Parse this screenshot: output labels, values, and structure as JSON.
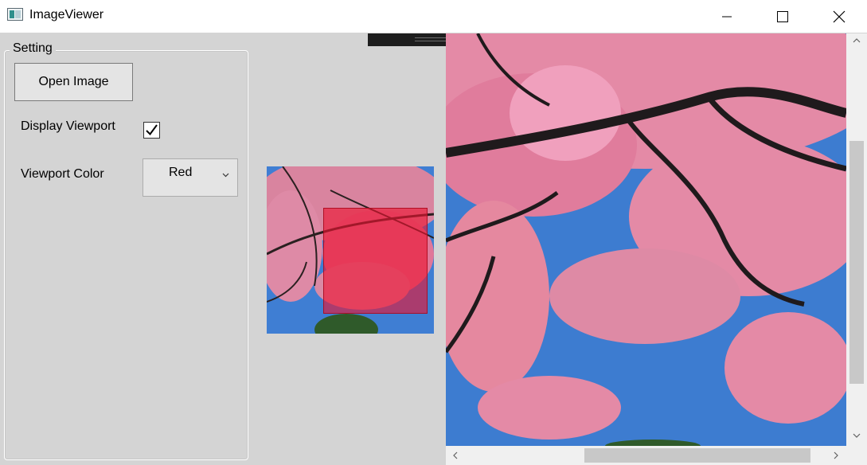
{
  "window": {
    "title": "ImageViewer",
    "icon": "app-window-icon"
  },
  "settings": {
    "group_label": "Setting",
    "open_button_label": "Open Image",
    "display_viewport_label": "Display Viewport",
    "display_viewport_checked": true,
    "viewport_color_label": "Viewport Color",
    "viewport_color_value": "Red"
  },
  "colors": {
    "viewport": "#e8142f",
    "panel_background": "#d4d4d4",
    "sky": "#3f7ed3",
    "blossom": "#e9789b"
  },
  "scrollbars": {
    "vertical_position": 0.25,
    "horizontal_position": 0.4
  }
}
